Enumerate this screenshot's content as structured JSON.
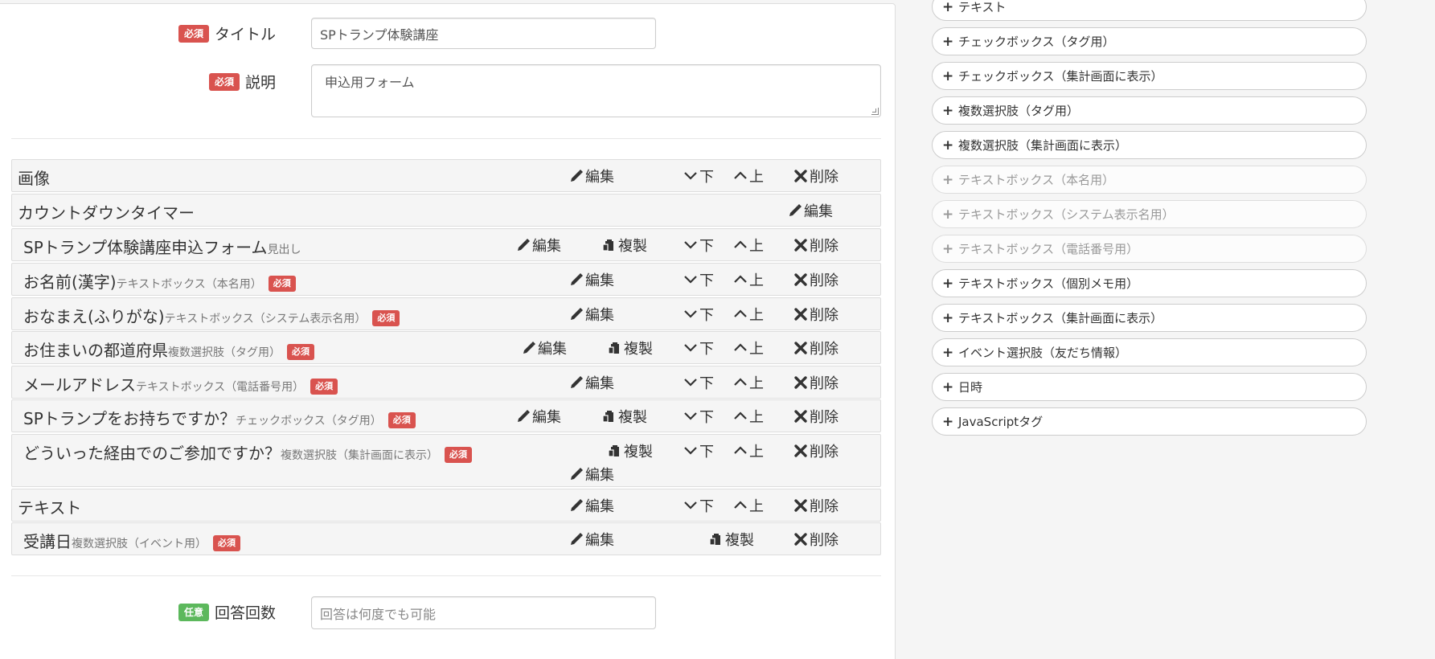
{
  "form": {
    "required_badge": "必須",
    "optional_badge": "任意",
    "title_label": "タイトル",
    "title_value": "SPトランプ体験講座",
    "desc_label": "説明",
    "desc_value": "申込用フォーム",
    "answer_label": "回答回数",
    "answer_placeholder": "回答は何度でも可能"
  },
  "actions": {
    "edit": "編集",
    "duplicate": "複製",
    "down": "下",
    "up": "上",
    "delete": "削除"
  },
  "items": [
    {
      "title": "画像",
      "sub": "",
      "required": false
    },
    {
      "title": "カウントダウンタイマー",
      "sub": "",
      "required": false
    },
    {
      "title": "SPトランプ体験講座申込フォーム",
      "sub": "見出し",
      "required": false
    },
    {
      "title": "お名前(漢字)",
      "sub": "テキストボックス（本名用）",
      "required": true
    },
    {
      "title": "おなまえ(ふりがな)",
      "sub": "テキストボックス（システム表示名用）",
      "required": true
    },
    {
      "title": "お住まいの都道府県",
      "sub": "複数選択肢（タグ用）",
      "required": true
    },
    {
      "title": "メールアドレス",
      "sub": "テキストボックス（電話番号用）",
      "required": true
    },
    {
      "title": "SPトランプをお持ちですか？",
      "sub": "チェックボックス（タグ用）",
      "required": true
    },
    {
      "title": "どういった経由でのご参加ですか？",
      "sub": "複数選択肢（集計画面に表示）",
      "required": true
    },
    {
      "title": "テキスト",
      "sub": "",
      "required": false
    },
    {
      "title": "受講日",
      "sub": "複数選択肢（イベント用）",
      "required": true
    }
  ],
  "palette": [
    {
      "label": "テキスト",
      "disabled": false
    },
    {
      "label": "チェックボックス（タグ用）",
      "disabled": false
    },
    {
      "label": "チェックボックス（集計画面に表示）",
      "disabled": false
    },
    {
      "label": "複数選択肢（タグ用）",
      "disabled": false
    },
    {
      "label": "複数選択肢（集計画面に表示）",
      "disabled": false
    },
    {
      "label": "テキストボックス（本名用）",
      "disabled": true
    },
    {
      "label": "テキストボックス（システム表示名用）",
      "disabled": true
    },
    {
      "label": "テキストボックス（電話番号用）",
      "disabled": true
    },
    {
      "label": "テキストボックス（個別メモ用）",
      "disabled": false
    },
    {
      "label": "テキストボックス（集計画面に表示）",
      "disabled": false
    },
    {
      "label": "イベント選択肢（友だち情報）",
      "disabled": false
    },
    {
      "label": "日時",
      "disabled": false
    },
    {
      "label": "JavaScriptタグ",
      "disabled": false
    }
  ],
  "icons": [
    "pencil-icon",
    "clipboard-icon",
    "chevron-down-icon",
    "chevron-up-icon",
    "close-icon",
    "plus-icon"
  ],
  "colors": {
    "required": "#d9534f",
    "optional": "#5cb85c"
  }
}
